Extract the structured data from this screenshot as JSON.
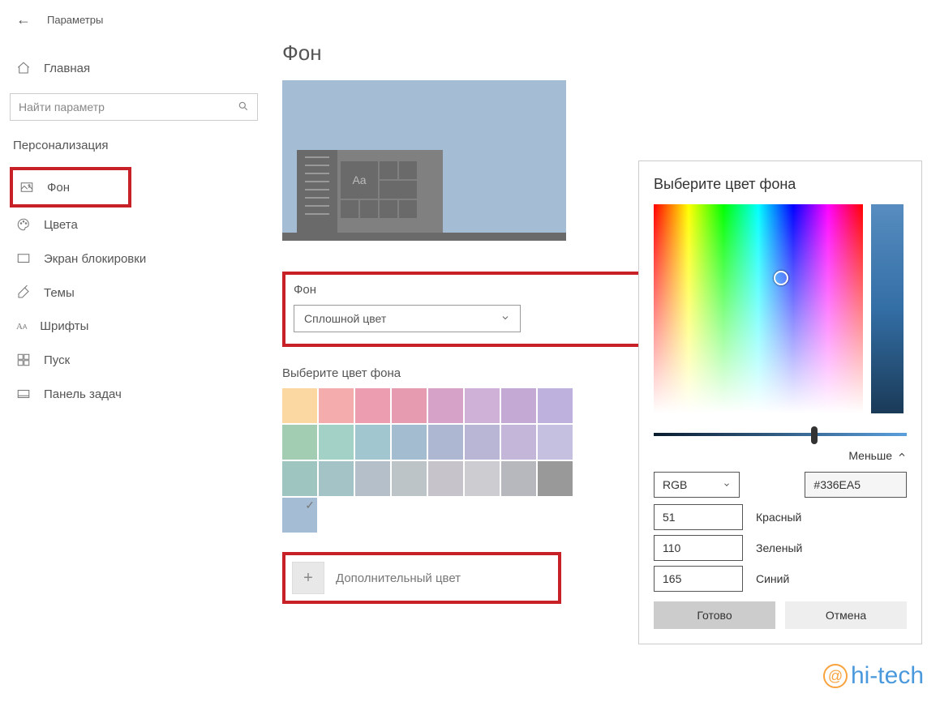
{
  "header": {
    "app_title": "Параметры"
  },
  "sidebar": {
    "home": "Главная",
    "search_placeholder": "Найти параметр",
    "section": "Персонализация",
    "items": [
      {
        "label": "Фон"
      },
      {
        "label": "Цвета"
      },
      {
        "label": "Экран блокировки"
      },
      {
        "label": "Темы"
      },
      {
        "label": "Шрифты"
      },
      {
        "label": "Пуск"
      },
      {
        "label": "Панель задач"
      }
    ]
  },
  "main": {
    "heading": "Фон",
    "preview_sample": "Aa",
    "bg_label": "Фон",
    "bg_dropdown_value": "Сплошной цвет",
    "pick_color_label": "Выберите цвет фона",
    "swatches": [
      "#fbd7a1",
      "#f4adac",
      "#ed9db0",
      "#e79bb1",
      "#d7a2c8",
      "#cfb0d6",
      "#c4a9d5",
      "#bfb1de",
      "#a2cdb3",
      "#a3d1c5",
      "#a2c6d0",
      "#a4bcd0",
      "#aeb7d2",
      "#b9b5d5",
      "#c4b6d8",
      "#c5bfe0",
      "#9ec5c0",
      "#a4c3c7",
      "#b4bfc9",
      "#bdc4c7",
      "#c6c3ca",
      "#cdccd0",
      "#b7b7be",
      "#999999"
    ],
    "selected_swatch": "#a4bcd4",
    "extra_color_label": "Дополнительный цвет"
  },
  "picker": {
    "title": "Выберите цвет фона",
    "less": "Меньше",
    "mode": "RGB",
    "hex": "#336EA5",
    "r_value": "51",
    "r_label": "Красный",
    "g_value": "110",
    "g_label": "Зеленый",
    "b_value": "165",
    "b_label": "Синий",
    "ok": "Готово",
    "cancel": "Отмена"
  },
  "watermark": "hi-tech"
}
